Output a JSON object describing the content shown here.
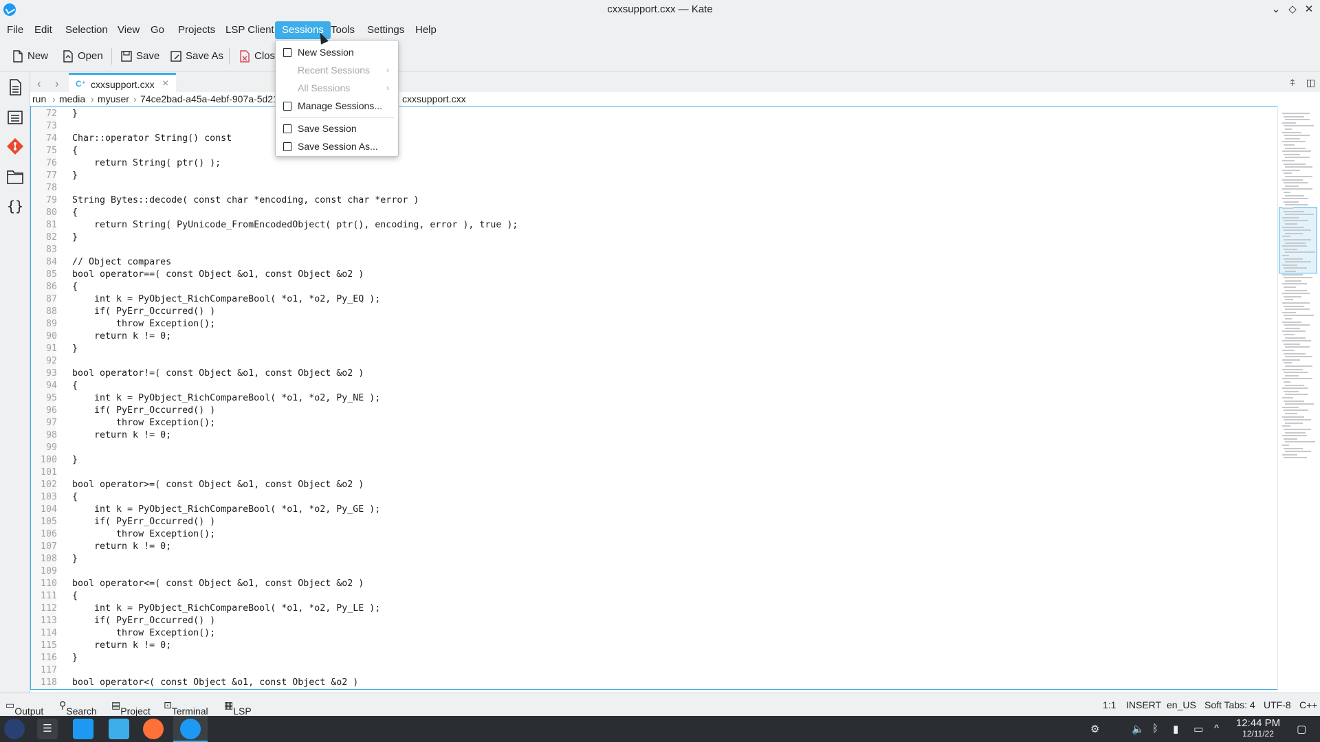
{
  "window": {
    "title": "cxxsupport.cxx — Kate"
  },
  "menubar": {
    "items": [
      "File",
      "Edit",
      "Selection",
      "View",
      "Go",
      "Projects",
      "LSP Client",
      "Sessions",
      "Tools",
      "Settings",
      "Help"
    ],
    "active": "Sessions"
  },
  "toolbar": {
    "new": "New",
    "open": "Open",
    "save": "Save",
    "save_as": "Save As",
    "close": "Close"
  },
  "tab": {
    "label": "cxxsupport.cxx"
  },
  "breadcrumb": [
    "run",
    "media",
    "myuser",
    "74ce2bad-a45a-4ebf-907a-5d21",
    "cxxsupport.cxx"
  ],
  "sessions_menu": {
    "new_session": "New Session",
    "recent_sessions": "Recent Sessions",
    "all_sessions": "All Sessions",
    "manage_sessions": "Manage Sessions...",
    "save_session": "Save Session",
    "save_session_as": "Save Session As..."
  },
  "code": {
    "first_line": 72,
    "lines": [
      "}",
      "",
      "Char::operator String() const",
      "{",
      "    return String( ptr() );",
      "}",
      "",
      "String Bytes::decode( const char *encoding, const char *error )",
      "{",
      "    return String( PyUnicode_FromEncodedObject( ptr(), encoding, error ), true );",
      "}",
      "",
      "// Object compares",
      "bool operator==( const Object &o1, const Object &o2 )",
      "{",
      "    int k = PyObject_RichCompareBool( *o1, *o2, Py_EQ );",
      "    if( PyErr_Occurred() )",
      "        throw Exception();",
      "    return k != 0;",
      "}",
      "",
      "bool operator!=( const Object &o1, const Object &o2 )",
      "{",
      "    int k = PyObject_RichCompareBool( *o1, *o2, Py_NE );",
      "    if( PyErr_Occurred() )",
      "        throw Exception();",
      "    return k != 0;",
      "",
      "}",
      "",
      "bool operator>=( const Object &o1, const Object &o2 )",
      "{",
      "    int k = PyObject_RichCompareBool( *o1, *o2, Py_GE );",
      "    if( PyErr_Occurred() )",
      "        throw Exception();",
      "    return k != 0;",
      "}",
      "",
      "bool operator<=( const Object &o1, const Object &o2 )",
      "{",
      "    int k = PyObject_RichCompareBool( *o1, *o2, Py_LE );",
      "    if( PyErr_Occurred() )",
      "        throw Exception();",
      "    return k != 0;",
      "}",
      "",
      "bool operator<( const Object &o1, const Object &o2 )"
    ]
  },
  "statusbar": {
    "output": "Output",
    "search": "Search",
    "project": "Project",
    "terminal": "Terminal",
    "lsp": "LSP",
    "cursor_pos": "1:1",
    "mode": "INSERT",
    "language": "en_US",
    "indent": "Soft Tabs: 4",
    "encoding": "UTF-8",
    "syntax": "C++"
  },
  "taskbar": {
    "time": "12:44 PM",
    "date": "12/11/22"
  },
  "colors": {
    "accent": "#3daee9",
    "background": "#eff0f1",
    "taskbar": "#2a2e32"
  }
}
